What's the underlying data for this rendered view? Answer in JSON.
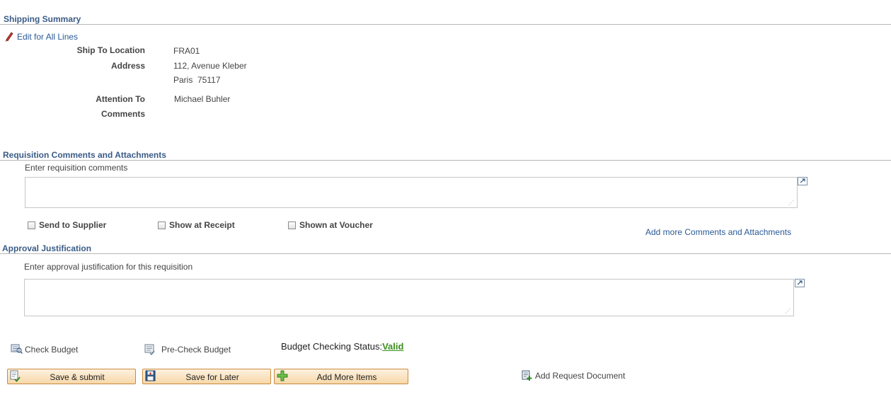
{
  "shipping": {
    "title": "Shipping Summary",
    "edit_link": "Edit for All Lines",
    "ship_to_label": "Ship To Location",
    "ship_to_value": "FRA01",
    "address_label": "Address",
    "address_line1": "112, Avenue Kleber",
    "address_line2": "Paris  75117",
    "attention_label": "Attention To",
    "attention_value": "Michael Buhler",
    "comments_label": "Comments"
  },
  "req_comments": {
    "title": "Requisition Comments and Attachments",
    "prompt": "Enter requisition comments",
    "value": "",
    "send_to_supplier": "Send to Supplier",
    "show_at_receipt": "Show at Receipt",
    "shown_at_voucher": "Shown at Voucher",
    "add_more_link": "Add more Comments and Attachments"
  },
  "approval": {
    "title": "Approval Justification",
    "prompt": "Enter approval justification for this requisition",
    "value": ""
  },
  "budget": {
    "check_budget": "Check Budget",
    "precheck_budget": "Pre-Check Budget",
    "status_label": "Budget Checking Status:",
    "status_value": "Valid"
  },
  "actions": {
    "save_submit": "Save & submit",
    "save_later": "Save for Later",
    "add_more_items": "Add More Items",
    "add_request_doc": "Add Request Document"
  },
  "colors": {
    "section_title": "#3a5b87",
    "link": "#2a5a96",
    "valid_status": "#3a8f1c",
    "button_border": "#c98a3b"
  }
}
